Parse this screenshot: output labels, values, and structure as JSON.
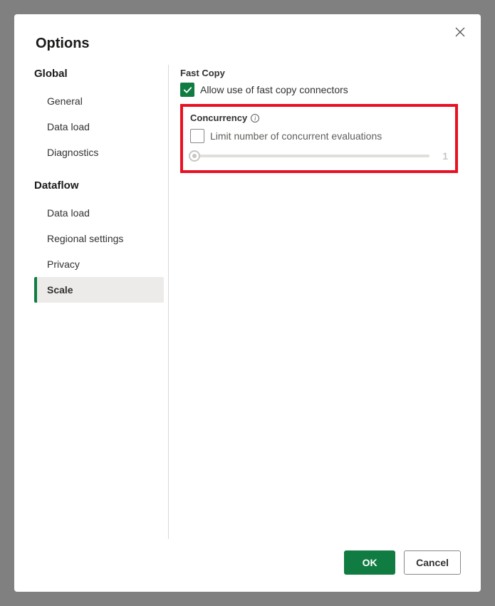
{
  "title": "Options",
  "sidebar": {
    "global_header": "Global",
    "dataflow_header": "Dataflow",
    "global_items": [
      {
        "label": "General"
      },
      {
        "label": "Data load"
      },
      {
        "label": "Diagnostics"
      }
    ],
    "dataflow_items": [
      {
        "label": "Data load"
      },
      {
        "label": "Regional settings"
      },
      {
        "label": "Privacy"
      },
      {
        "label": "Scale",
        "selected": true
      }
    ]
  },
  "content": {
    "fastcopy_header": "Fast Copy",
    "fastcopy_option": "Allow use of fast copy connectors",
    "fastcopy_checked": true,
    "concurrency_header": "Concurrency",
    "concurrency_option": "Limit number of concurrent evaluations",
    "concurrency_checked": false,
    "slider_value": "1"
  },
  "footer": {
    "ok": "OK",
    "cancel": "Cancel"
  }
}
